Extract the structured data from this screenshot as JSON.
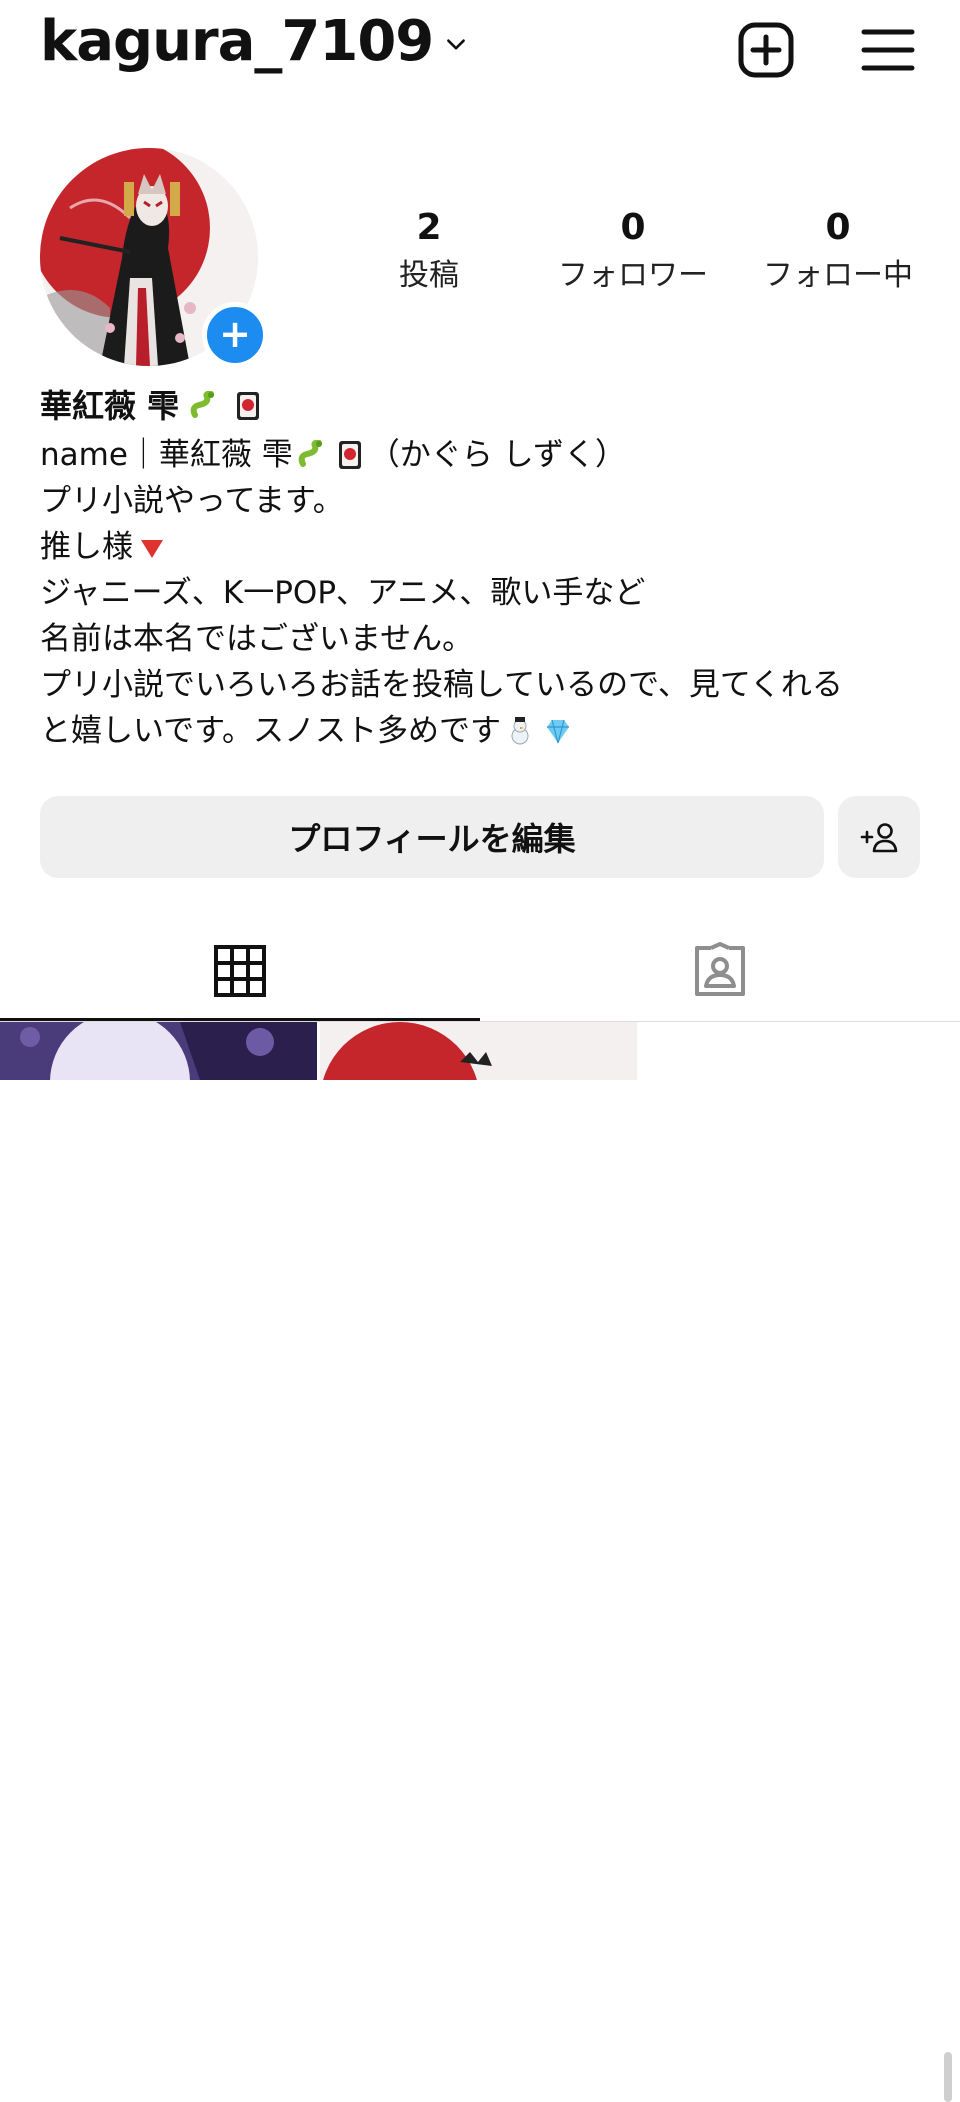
{
  "header": {
    "username": "kagura_7109",
    "icons": {
      "dropdown": "chevron-down-icon",
      "create": "plus-square-icon",
      "menu": "hamburger-menu-icon"
    }
  },
  "profile": {
    "avatar_add_icon": "plus-icon",
    "stats": {
      "posts": {
        "count": "2",
        "label": "投稿"
      },
      "followers": {
        "count": "0",
        "label": "フォロワー"
      },
      "following": {
        "count": "0",
        "label": "フォロー中"
      }
    },
    "display_name": "華紅薇 雫",
    "display_name_emojis": [
      "snake-emoji",
      "hanafuda-card-emoji"
    ],
    "bio": {
      "line1_before": "name｜華紅薇 雫",
      "line1_after": "（かぐら しずく）",
      "line2": "プリ小説やってます。",
      "line3": "推し様",
      "line4": "ジャニーズ、K一POP、アニメ、歌い手など",
      "line5": "名前は本名ではございません。",
      "line6": "プリ小説でいろいろお話を投稿しているので、見てくれる",
      "line7": "と嬉しいです。スノスト多めです"
    }
  },
  "buttons": {
    "edit_profile": "プロフィールを編集",
    "add_person_icon": "add-person-icon"
  },
  "tabs": [
    {
      "name": "grid",
      "icon": "grid-icon",
      "active": true
    },
    {
      "name": "tagged",
      "icon": "tagged-person-icon",
      "active": false
    }
  ],
  "colors": {
    "accent_blue": "#1d8cf0",
    "button_bg": "#efefef",
    "text": "#111111"
  }
}
